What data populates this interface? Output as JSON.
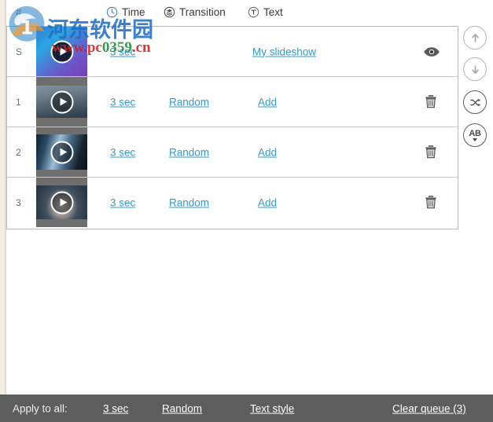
{
  "columns": {
    "index_label": "#",
    "time": {
      "label": "Time",
      "icon": "clock-icon"
    },
    "transition": {
      "label": "Transition",
      "icon": "layers-icon"
    },
    "text": {
      "label": "Text",
      "icon": "text-circle-icon"
    }
  },
  "queue": {
    "rows": [
      {
        "index": "S",
        "thumb": "slideshow-gradient-thumbnail",
        "time": "3 sec",
        "transition": "",
        "text": "",
        "title": "My slideshow",
        "action_icon": "eye-icon",
        "action_name": "preview-slideshow-button"
      },
      {
        "index": "1",
        "thumb": "video-thumbnail-landscape",
        "time": "3 sec",
        "transition": "Random",
        "text": "Add",
        "title": "",
        "action_icon": "trash-icon",
        "action_name": "delete-item-button"
      },
      {
        "index": "2",
        "thumb": "video-thumbnail-building",
        "time": "3 sec",
        "transition": "Random",
        "text": "Add",
        "title": "",
        "action_icon": "trash-icon",
        "action_name": "delete-item-button"
      },
      {
        "index": "3",
        "thumb": "video-thumbnail-person",
        "time": "3 sec",
        "transition": "Random",
        "text": "Add",
        "title": "",
        "action_icon": "trash-icon",
        "action_name": "delete-item-button"
      }
    ]
  },
  "side_tools": [
    {
      "name": "move-up-button",
      "icon": "arrow-up-icon",
      "label": ""
    },
    {
      "name": "move-down-button",
      "icon": "arrow-down-icon",
      "label": ""
    },
    {
      "name": "shuffle-button",
      "icon": "shuffle-icon",
      "label": ""
    },
    {
      "name": "sort-alphabetically-button",
      "icon": "ab-sort-icon",
      "label": "AB"
    }
  ],
  "bottom_bar": {
    "apply_label": "Apply to all:",
    "time": "3 sec",
    "transition": "Random",
    "text_style": "Text style",
    "clear_queue": "Clear queue (3)"
  },
  "watermark": {
    "site_name": "河东软件园",
    "url_prefix": "www.pc",
    "url_digits": "0359",
    "url_suffix": ".cn"
  },
  "colors": {
    "link": "#2e9bd1",
    "bottom_bar": "#5d5d5d",
    "panel_border": "#b9b9b9",
    "watermark_blue": "#1f6fc4",
    "watermark_red": "#cc2222"
  }
}
